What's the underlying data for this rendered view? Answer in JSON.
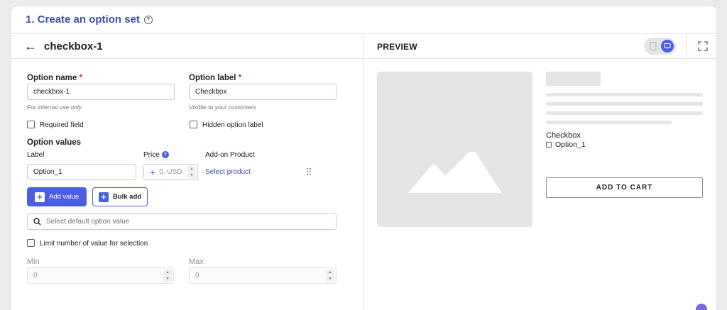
{
  "section": {
    "title": "1. Create an option set",
    "help_icon": "question-circle-icon"
  },
  "editor": {
    "back_icon": "arrow-left-icon",
    "title": "checkbox-1",
    "option_name": {
      "label": "Option name",
      "required_mark": "*",
      "value": "checkbox-1",
      "help": "For internal use only"
    },
    "option_label": {
      "label": "Option label",
      "required_mark": "*",
      "value": "Checkbox",
      "help": "Visible to your customers"
    },
    "required_field": {
      "label": "Required field",
      "checked": false
    },
    "hidden_label": {
      "label": "Hidden option label",
      "checked": false
    },
    "option_values": {
      "heading": "Option values",
      "col_label": "Label",
      "col_price": "Price",
      "col_addon": "Add-on Product",
      "rows": [
        {
          "label": "Option_1",
          "price_prefix": "+",
          "price_placeholder": "0. USD",
          "addon_link": "Select product"
        }
      ]
    },
    "add_value_label": "Add value",
    "bulk_add_label": "Bulk add",
    "default_search_placeholder": "Select default option value",
    "limit_selection": {
      "label": "Limit number of value for selection",
      "checked": false
    },
    "min": {
      "label": "Min",
      "value": "0"
    },
    "max": {
      "label": "Max",
      "value": "0"
    }
  },
  "preview": {
    "title": "PREVIEW",
    "device_toggle": {
      "mobile_icon": "mobile-icon",
      "desktop_icon": "desktop-icon",
      "active": "desktop"
    },
    "fullscreen_icon": "expand-icon",
    "image_icon": "mountain-image-icon",
    "option_label": "Checkbox",
    "option_value": "Option_1",
    "add_to_cart": "ADD TO CART"
  },
  "colors": {
    "accent": "#4b5de3",
    "title": "#3f4eae",
    "required": "#d82c0d",
    "placeholder_bg": "#e4e5e7"
  }
}
